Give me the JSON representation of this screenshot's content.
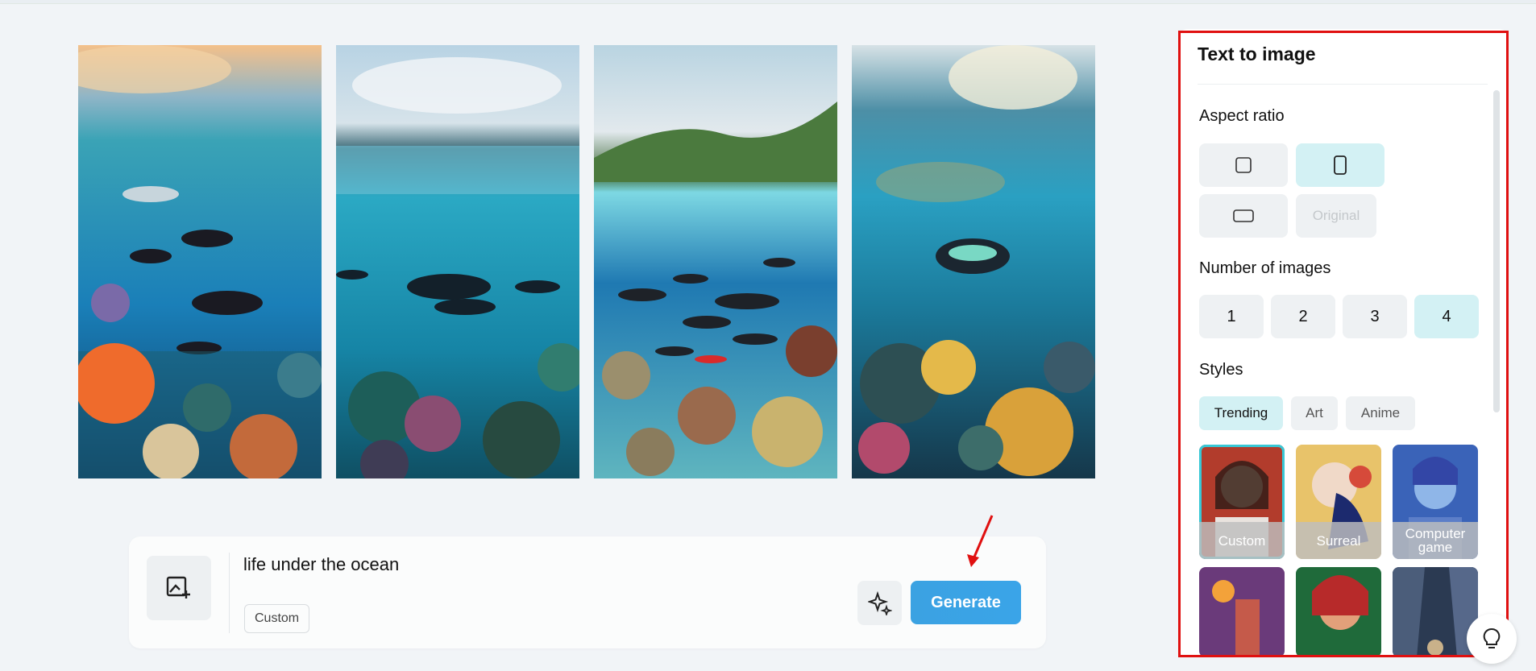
{
  "prompt": {
    "text": "life under the ocean",
    "style_tag": "Custom",
    "generate_label": "Generate"
  },
  "gallery": {
    "images": [
      {
        "alt": "underwater scene 1"
      },
      {
        "alt": "underwater scene 2"
      },
      {
        "alt": "underwater scene 3"
      },
      {
        "alt": "underwater scene 4"
      }
    ]
  },
  "panel": {
    "title": "Text to image",
    "aspect_ratio": {
      "label": "Aspect ratio",
      "options": [
        "square",
        "portrait",
        "landscape",
        "Original"
      ],
      "selected": "portrait"
    },
    "num_images": {
      "label": "Number of images",
      "options": [
        "1",
        "2",
        "3",
        "4"
      ],
      "selected": "4"
    },
    "styles": {
      "label": "Styles",
      "tabs": [
        "Trending",
        "Art",
        "Anime"
      ],
      "selected_tab": "Trending",
      "cards": [
        "Custom",
        "Surreal",
        "Computer game"
      ],
      "selected_card": "Custom"
    }
  },
  "colors": {
    "accent": "#3ba2e2",
    "selected_bg": "#d3f1f4",
    "highlight_outline": "#e01010"
  },
  "icons": [
    "image-add-icon",
    "sparkle-icon",
    "lightbulb-icon",
    "square-ratio-icon",
    "portrait-ratio-icon",
    "landscape-ratio-icon"
  ]
}
